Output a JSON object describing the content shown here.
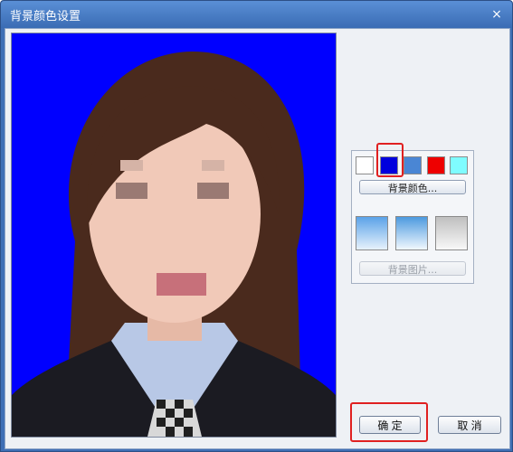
{
  "window": {
    "title": "背景颜色设置",
    "close_glyph": "×"
  },
  "photo": {
    "background_color": "#0000ff",
    "description_icon": "portrait-photo"
  },
  "options": {
    "swatches": [
      {
        "name": "white",
        "color": "#ffffff",
        "selected": false
      },
      {
        "name": "blue",
        "color": "#0000dd",
        "selected": true
      },
      {
        "name": "steel-blue",
        "color": "#4a86d4",
        "selected": false
      },
      {
        "name": "red",
        "color": "#ee0000",
        "selected": false
      },
      {
        "name": "cyan",
        "color": "#7ffcff",
        "selected": false
      }
    ],
    "bg_color_button": "背景颜色...",
    "bg_image_button": "背景图片...",
    "tiles": [
      "gradient-blue-1",
      "gradient-blue-2",
      "gradient-gray"
    ]
  },
  "buttons": {
    "ok": "确 定",
    "cancel": "取 消"
  },
  "colors": {
    "highlight": "#e02020",
    "accent": "#3f6fb5"
  }
}
